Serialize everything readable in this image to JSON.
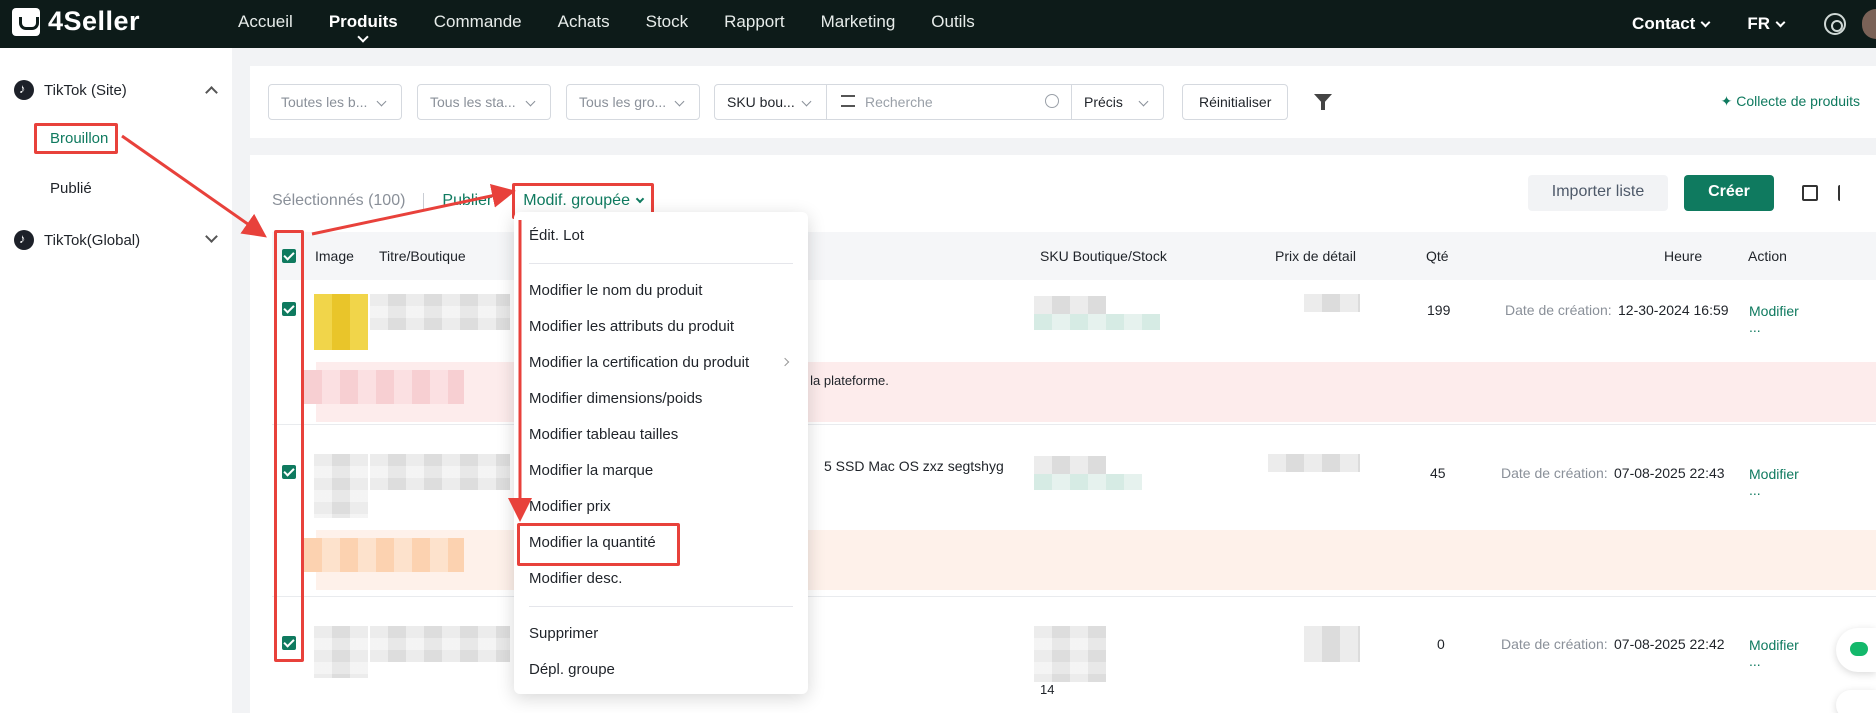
{
  "topbar": {
    "logo": "4Seller",
    "nav": [
      "Accueil",
      "Produits",
      "Commande",
      "Achats",
      "Stock",
      "Rapport",
      "Marketing",
      "Outils"
    ],
    "active_nav": "Produits",
    "contact": "Contact",
    "lang": "FR"
  },
  "sidebar": {
    "group1": "TikTok (Site)",
    "sub_draft": "Brouillon",
    "sub_published": "Publié",
    "group2": "TikTok(Global)"
  },
  "filters": {
    "brand": "Toutes les b...",
    "status": "Tous les sta...",
    "group": "Tous les gro...",
    "sku_type": "SKU bou...",
    "search_placeholder": "Recherche",
    "match": "Précis",
    "reset": "Réinitialiser",
    "collect": "Collecte de produits"
  },
  "actions": {
    "selected": "Sélectionnés (100)",
    "publish": "Publier",
    "bulk_edit": "Modif. groupée",
    "import": "Importer liste",
    "create": "Créer"
  },
  "table": {
    "headers": {
      "image": "Image",
      "title": "Titre/Boutique",
      "sku": "SKU Boutique/Stock",
      "price": "Prix de détail",
      "qty": "Qté",
      "time": "Heure",
      "action": "Action"
    },
    "rows": [
      {
        "qty": "199",
        "created_label": "Date de création:",
        "created": "12-30-2024 16:59",
        "action": "Modifier",
        "more": "...",
        "warning": "es une demande sur la plateforme."
      },
      {
        "qty": "45",
        "created_label": "Date de création:",
        "created": "07-08-2025 22:43",
        "action": "Modifier",
        "more": "...",
        "title_fragment": "5 SSD Mac OS zxz segtshyg"
      },
      {
        "qty": "0",
        "created_label": "Date de création:",
        "created": "07-08-2025 22:42",
        "action": "Modifier",
        "more": "...",
        "sku_count": "14"
      }
    ]
  },
  "menu": {
    "items": [
      "Édit. Lot",
      "Modifier le nom du produit",
      "Modifier les attributs du produit",
      "Modifier la certification du produit",
      "Modifier dimensions/poids",
      "Modifier tableau tailles",
      "Modifier la marque",
      "Modifier prix",
      "Modifier la quantité",
      "Modifier desc.",
      "Supprimer",
      "Dépl. groupe"
    ]
  },
  "colors": {
    "accent": "#0f7a5f",
    "annotation": "#e8413b",
    "topbar": "#0d1b19"
  }
}
